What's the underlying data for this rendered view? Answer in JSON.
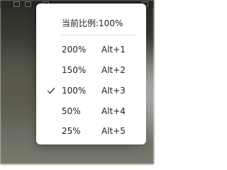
{
  "menu": {
    "current_label": "当前比例:100%",
    "items": [
      {
        "label": "200%",
        "shortcut": "Alt+1",
        "checked": false
      },
      {
        "label": "150%",
        "shortcut": "Alt+2",
        "checked": false
      },
      {
        "label": "100%",
        "shortcut": "Alt+3",
        "checked": true
      },
      {
        "label": "50%",
        "shortcut": "Alt+4",
        "checked": false
      },
      {
        "label": "25%",
        "shortcut": "Alt+5",
        "checked": false
      }
    ]
  },
  "icons": {
    "check": "checkmark-icon"
  },
  "colors": {
    "menu_bg": "#ffffff",
    "text": "#202020",
    "check": "#404040"
  }
}
